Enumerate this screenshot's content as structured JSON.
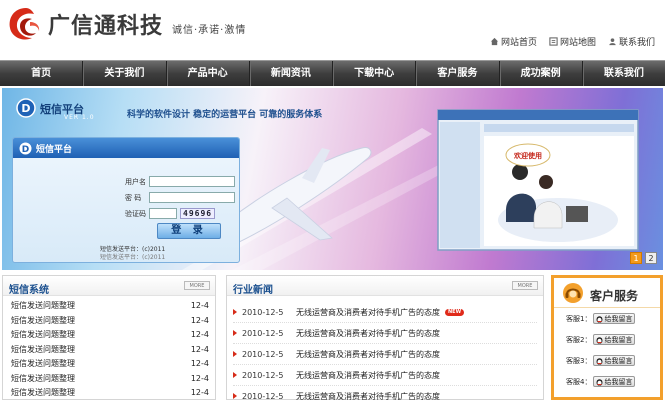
{
  "header": {
    "logo_text": "广信通科技",
    "slogan": "诚信·承诺·激情",
    "links": [
      {
        "label": "网站首页",
        "icon": "home-icon"
      },
      {
        "label": "网站地图",
        "icon": "sitemap-icon"
      },
      {
        "label": "联系我们",
        "icon": "contact-icon"
      }
    ]
  },
  "nav": {
    "items": [
      "首页",
      "关于我们",
      "产品中心",
      "新闻资讯",
      "下载中心",
      "客户服务",
      "成功案例",
      "联系我们"
    ]
  },
  "banner": {
    "platform_title": "短信平台",
    "platform_subtitle": "VER 1.0",
    "tagline": "科学的软件设计 稳定的运营平台 可靠的服务体系",
    "login": {
      "title": "短信平台",
      "username_label": "用户名",
      "password_label": "密 码",
      "captcha_label": "验证码",
      "captcha_value": "49696",
      "login_button": "登 录",
      "copyright_line1": "短信发送平台：(c)2011",
      "copyright_line2": "短信发送平台：(c)2011"
    },
    "screen_welcome": "欢迎使用",
    "slides": [
      "1",
      "2"
    ],
    "active_slide": 0
  },
  "sms_system": {
    "title": "短信系统",
    "more": "MORE",
    "items": [
      {
        "title": "短信发送问题整理",
        "date": "12-4"
      },
      {
        "title": "短信发送问题整理",
        "date": "12-4"
      },
      {
        "title": "短信发送问题整理",
        "date": "12-4"
      },
      {
        "title": "短信发送问题整理",
        "date": "12-4"
      },
      {
        "title": "短信发送问题整理",
        "date": "12-4"
      },
      {
        "title": "短信发送问题整理",
        "date": "12-4"
      },
      {
        "title": "短信发送问题整理",
        "date": "12-4"
      }
    ]
  },
  "industry_news": {
    "title": "行业新闻",
    "more": "MORE",
    "new_badge": "NEW",
    "items": [
      {
        "date": "2010-12-5",
        "title": "无线运营商及消费者对待手机广告的态度",
        "new": true
      },
      {
        "date": "2010-12-5",
        "title": "无线运营商及消费者对待手机广告的态度",
        "new": false
      },
      {
        "date": "2010-12-5",
        "title": "无线运营商及消费者对待手机广告的态度",
        "new": false
      },
      {
        "date": "2010-12-5",
        "title": "无线运营商及消费者对待手机广告的态度",
        "new": false
      },
      {
        "date": "2010-12-5",
        "title": "无线运营商及消费者对待手机广告的态度",
        "new": false
      }
    ]
  },
  "customer_service": {
    "title": "客户服务",
    "reps": [
      {
        "label": "客服1：",
        "button": "给我留言"
      },
      {
        "label": "客服2：",
        "button": "给我留言"
      },
      {
        "label": "客服3：",
        "button": "给我留言"
      },
      {
        "label": "客服4：",
        "button": "给我留言"
      }
    ]
  },
  "colors": {
    "accent_red": "#d62b18",
    "nav_dark": "#3e3e3e",
    "service_orange": "#f3a02c",
    "title_blue": "#1a4f8e"
  }
}
